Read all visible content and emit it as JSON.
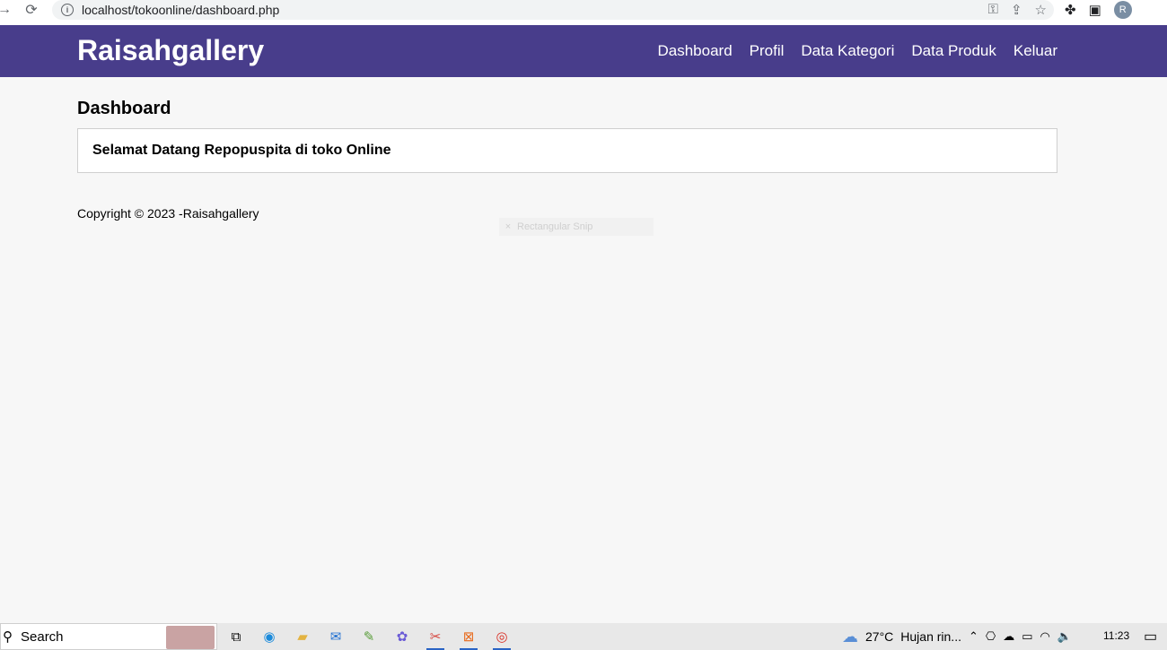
{
  "browser": {
    "back_icon": "arrow-left",
    "reload_icon": "reload",
    "url": "localhost/tokoonline/dashboard.php",
    "avatar_initial": "R"
  },
  "site": {
    "brand": "Raisahgallery",
    "menu": [
      {
        "label": "Dashboard"
      },
      {
        "label": "Profil"
      },
      {
        "label": "Data Kategori"
      },
      {
        "label": "Data Produk"
      },
      {
        "label": "Keluar"
      }
    ],
    "header_color": "#483d8b"
  },
  "main": {
    "title": "Dashboard",
    "welcome": "Selamat Datang Repopuspita di toko Online"
  },
  "footer": {
    "copyright": "Copyright © 2023 -Raisahgallery"
  },
  "snip_overlay": {
    "label": "Rectangular Snip"
  },
  "taskbar": {
    "search_label": "Search",
    "weather_temp": "27°C",
    "weather_desc": "Hujan rin...",
    "time": "11:23"
  }
}
